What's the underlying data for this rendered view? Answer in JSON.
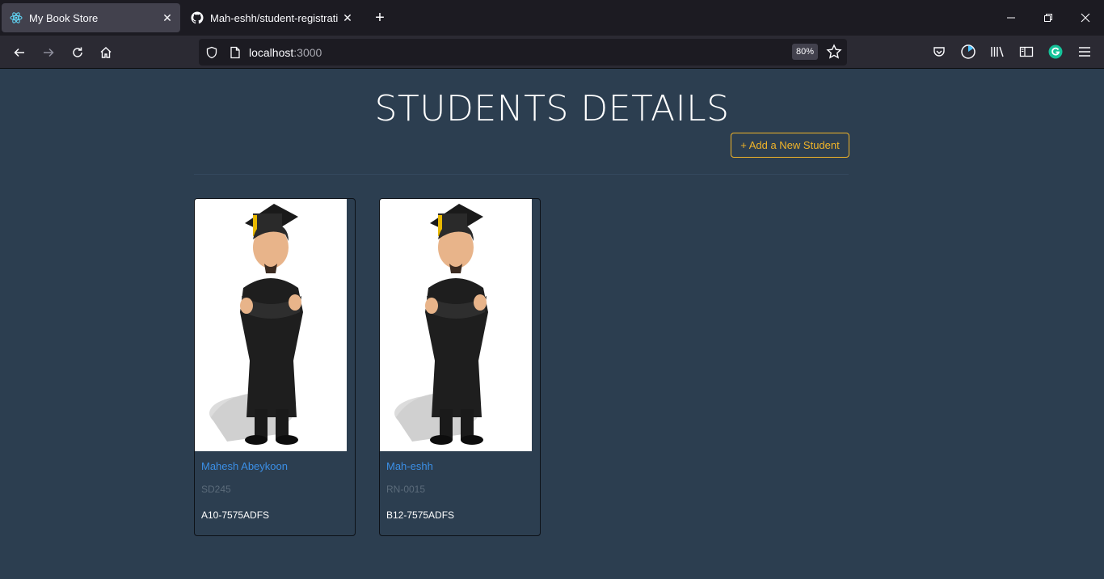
{
  "browser": {
    "tabs": [
      {
        "title": "My Book Store",
        "icon": "react-icon"
      },
      {
        "title": "Mah-eshh/student-registration",
        "icon": "github-icon"
      }
    ],
    "url_host": "localhost",
    "url_port": ":3000",
    "zoom": "80%"
  },
  "page": {
    "title": "STUDENTS DETAILS",
    "add_button": "+ Add a New Student"
  },
  "students": [
    {
      "name": "Mahesh Abeykoon",
      "reg": "SD245",
      "code": "A10-7575ADFS"
    },
    {
      "name": "Mah-eshh",
      "reg": "RN-0015",
      "code": "B12-7575ADFS"
    }
  ],
  "colors": {
    "background": "#2c3e50",
    "accent": "#f0b429",
    "link": "#3b8fe6"
  }
}
